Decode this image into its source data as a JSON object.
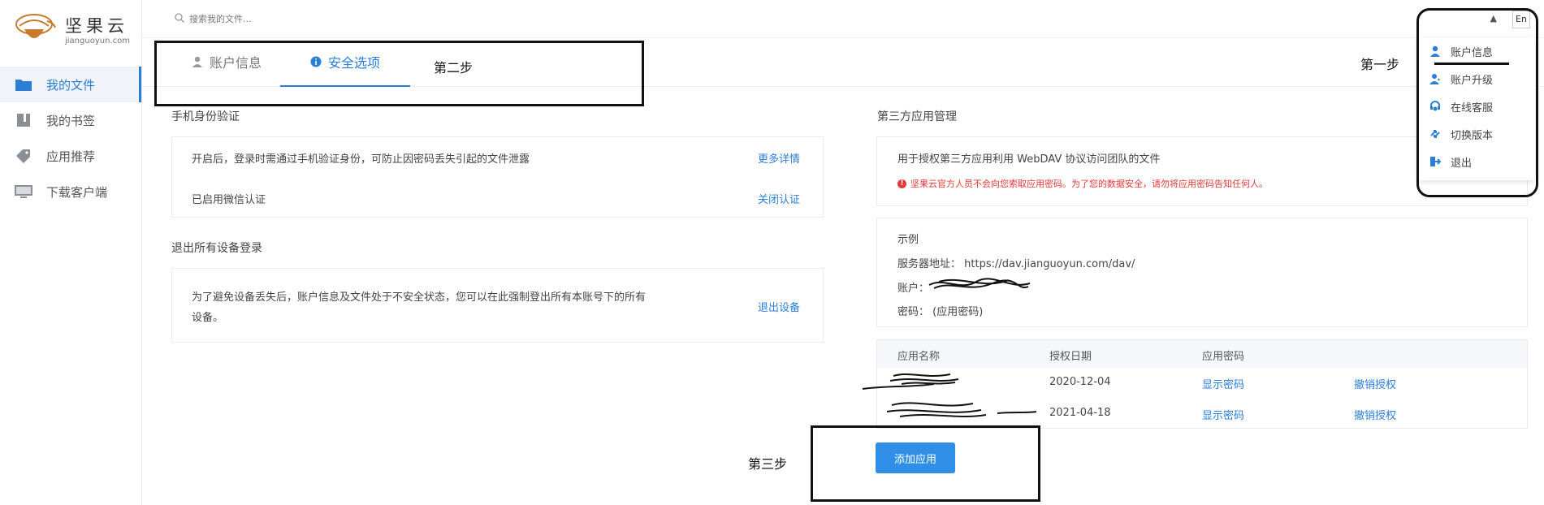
{
  "brand": {
    "name_cn": "坚果云",
    "name_en": "jianguoyun.com"
  },
  "sidebar": {
    "items": [
      {
        "label": "我的文件",
        "icon": "folder-icon",
        "active": true
      },
      {
        "label": "我的书签",
        "icon": "bookmark-icon",
        "active": false
      },
      {
        "label": "应用推荐",
        "icon": "tag-icon",
        "active": false
      },
      {
        "label": "下载客户端",
        "icon": "monitor-icon",
        "active": false
      }
    ]
  },
  "topbar": {
    "search_placeholder": "搜索我的文件...",
    "user_caret": "",
    "lang": "En"
  },
  "tabs": [
    {
      "label": "账户信息",
      "icon": "user-icon",
      "active": false
    },
    {
      "label": "安全选项",
      "icon": "info-icon",
      "active": true
    }
  ],
  "annotations": {
    "step1": "第一步",
    "step2": "第二步",
    "step3": "第三步"
  },
  "phone_auth": {
    "title": "手机身份验证",
    "desc": "开启后，登录时需通过手机验证身份，可防止因密码丢失引起的文件泄露",
    "more_link": "更多详情",
    "status": "已启用微信认证",
    "close_link": "关闭认证"
  },
  "logout_all": {
    "title": "退出所有设备登录",
    "desc_line1": "为了避免设备丢失后，账户信息及文件处于不安全状态，您可以在此强制登出所有本账号下的所有",
    "desc_line2": "设备。",
    "link": "退出设备"
  },
  "third_party": {
    "title": "第三方应用管理",
    "desc": "用于授权第三方应用利用 WebDAV 协议访问团队的文件",
    "warning": "坚果云官方人员不会向您索取应用密码。为了您的数据安全，请勿将应用密码告知任何人。",
    "example_title": "示例",
    "server_label": "服务器地址：",
    "server_value": "https://dav.jianguoyun.com/dav/",
    "account_label": "账户：",
    "password_label": "密码：",
    "password_value": "(应用密码)"
  },
  "table": {
    "headers": [
      "应用名称",
      "授权日期",
      "应用密码"
    ],
    "rows": [
      {
        "date": "2020-12-04",
        "show": "显示密码",
        "revoke": "撤销授权"
      },
      {
        "date": "2021-04-18",
        "show": "显示密码",
        "revoke": "撤销授权"
      }
    ]
  },
  "add_app_button": "添加应用",
  "dropdown": {
    "items": [
      {
        "label": "账户信息",
        "icon": "user-icon"
      },
      {
        "label": "账户升级",
        "icon": "user-upgrade-icon"
      },
      {
        "label": "在线客服",
        "icon": "headset-icon"
      },
      {
        "label": "切换版本",
        "icon": "switch-icon"
      },
      {
        "label": "退出",
        "icon": "logout-icon"
      }
    ]
  },
  "colors": {
    "accent": "#2b7ed8",
    "button": "#2f8fe7",
    "warning": "#e53935"
  }
}
